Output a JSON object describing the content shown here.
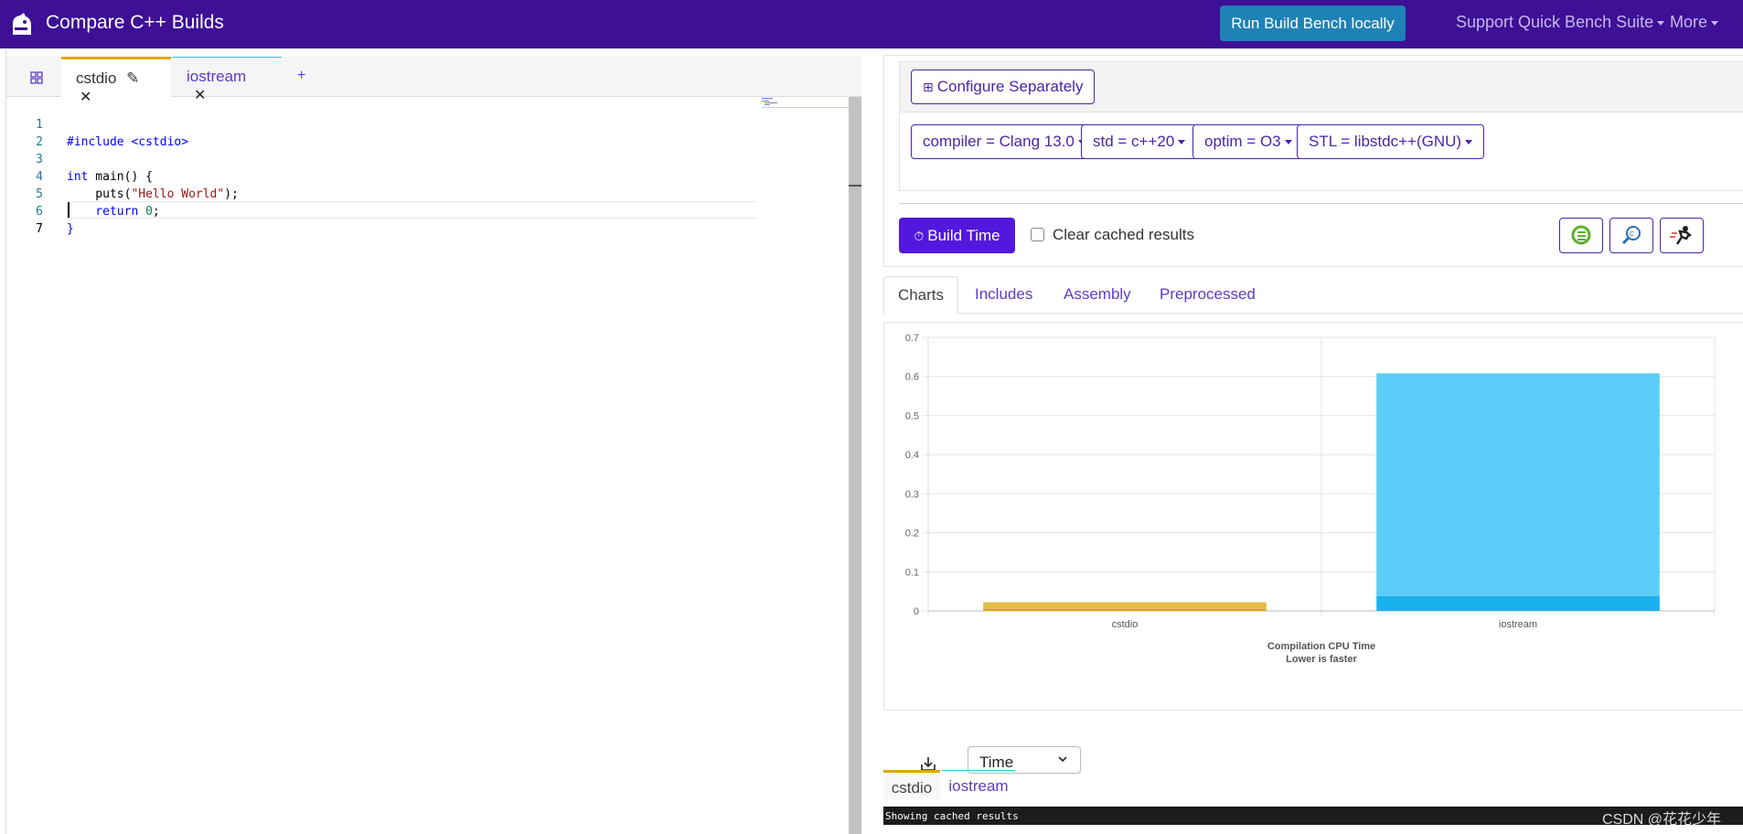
{
  "app": {
    "title": "Compare C++ Builds",
    "run_button": "Run Build Bench locally",
    "nav": {
      "support": "Support Quick Bench Suite",
      "more": "More"
    }
  },
  "editor": {
    "tabs": [
      {
        "label": "cstdio"
      },
      {
        "label": "iostream"
      }
    ],
    "add_tab": "+",
    "line_numbers": [
      "1",
      "2",
      "3",
      "4",
      "5",
      "6",
      "7"
    ],
    "code": {
      "line1": "#include <cstdio>",
      "line3_kw": "int",
      "line3_rest": " main() {",
      "line4_pre": "    puts(",
      "line4_str": "\"Hello World\"",
      "line4_post": ");",
      "line5_kw": "    return ",
      "line5_num": "0",
      "line5_post": ";",
      "line6": "}"
    }
  },
  "config": {
    "configure_button": "Configure Separately",
    "dropdowns": [
      "compiler = Clang 13.0",
      "std = c++20",
      "optim = O3",
      "STL = libstdc++(GNU)"
    ],
    "build_button": "Build Time",
    "clear_cache_label": "Clear cached results",
    "clear_cache_checked": false
  },
  "result_tabs": [
    "Charts",
    "Includes",
    "Assembly",
    "Preprocessed"
  ],
  "chart_data": {
    "type": "bar",
    "stacked": true,
    "categories": [
      "cstdio",
      "iostream"
    ],
    "series": [
      {
        "values": [
          0.005,
          0.038
        ],
        "colors": [
          "#d9a628",
          "#1ab1ef"
        ]
      },
      {
        "values": [
          0.017,
          0.57
        ],
        "colors": [
          "#e4bd47",
          "#5bcdf8"
        ]
      }
    ],
    "title": "Compilation CPU Time",
    "subtitle": "Lower is faster",
    "ylim": [
      0,
      0.7
    ],
    "yticks": [
      "0",
      "0.1",
      "0.2",
      "0.3",
      "0.4",
      "0.5",
      "0.6",
      "0.7"
    ],
    "grid": true
  },
  "bottom": {
    "select_value": "Time",
    "tabs": [
      "cstdio",
      "iostream"
    ],
    "status": "Showing cached results"
  },
  "watermark": "CSDN @花花少年"
}
